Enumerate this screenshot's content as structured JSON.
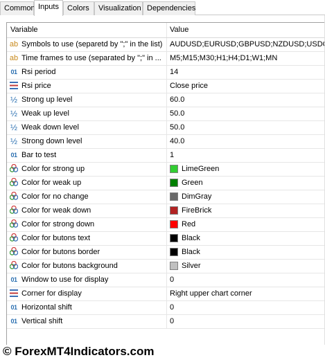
{
  "tabs": [
    {
      "label": "Common",
      "active": false
    },
    {
      "label": "Inputs",
      "active": true
    },
    {
      "label": "Colors",
      "active": false
    },
    {
      "label": "Visualization",
      "active": false
    },
    {
      "label": "Dependencies",
      "active": false
    }
  ],
  "grid": {
    "headers": {
      "variable": "Variable",
      "value": "Value"
    },
    "rows": [
      {
        "icon": "string-icon",
        "variable": "Symbols to use (separetd by \";\" in the list)",
        "value": "AUDUSD;EURUSD;GBPUSD;NZDUSD;USDCH...",
        "swatch": null
      },
      {
        "icon": "string-icon",
        "variable": "Time frames to use (separated by \";\" in ...",
        "value": "M5;M15;M30;H1;H4;D1;W1;MN",
        "swatch": null
      },
      {
        "icon": "integer-icon",
        "variable": "Rsi period",
        "value": "14",
        "swatch": null
      },
      {
        "icon": "enum-icon",
        "variable": "Rsi price",
        "value": "Close price",
        "swatch": null
      },
      {
        "icon": "double-icon",
        "variable": "Strong up level",
        "value": "60.0",
        "swatch": null
      },
      {
        "icon": "double-icon",
        "variable": "Weak up level",
        "value": "50.0",
        "swatch": null
      },
      {
        "icon": "double-icon",
        "variable": "Weak down level",
        "value": "50.0",
        "swatch": null
      },
      {
        "icon": "double-icon",
        "variable": "Strong down level",
        "value": "40.0",
        "swatch": null
      },
      {
        "icon": "integer-icon",
        "variable": "Bar to test",
        "value": "1",
        "swatch": null
      },
      {
        "icon": "color-icon",
        "variable": "Color for strong up",
        "value": "LimeGreen",
        "swatch": "#32cd32"
      },
      {
        "icon": "color-icon",
        "variable": "Color for weak up",
        "value": "Green",
        "swatch": "#008000"
      },
      {
        "icon": "color-icon",
        "variable": "Color for no change",
        "value": "DimGray",
        "swatch": "#696969"
      },
      {
        "icon": "color-icon",
        "variable": "Color for weak down",
        "value": "FireBrick",
        "swatch": "#b22222"
      },
      {
        "icon": "color-icon",
        "variable": "Color for strong down",
        "value": "Red",
        "swatch": "#ff0000"
      },
      {
        "icon": "color-icon",
        "variable": "Color for butons text",
        "value": "Black",
        "swatch": "#000000"
      },
      {
        "icon": "color-icon",
        "variable": "Color for butons border",
        "value": "Black",
        "swatch": "#000000"
      },
      {
        "icon": "color-icon",
        "variable": "Color for butons background",
        "value": "Silver",
        "swatch": "#c0c0c0"
      },
      {
        "icon": "integer-icon",
        "variable": "Window to use for display",
        "value": "0",
        "swatch": null
      },
      {
        "icon": "enum-icon",
        "variable": "Corner for display",
        "value": "Right upper chart corner",
        "swatch": null
      },
      {
        "icon": "integer-icon",
        "variable": "Horizontal shift",
        "value": "0",
        "swatch": null
      },
      {
        "icon": "integer-icon",
        "variable": "Vertical shift",
        "value": "0",
        "swatch": null
      }
    ]
  },
  "watermark": "© ForexMT4Indicators.com"
}
